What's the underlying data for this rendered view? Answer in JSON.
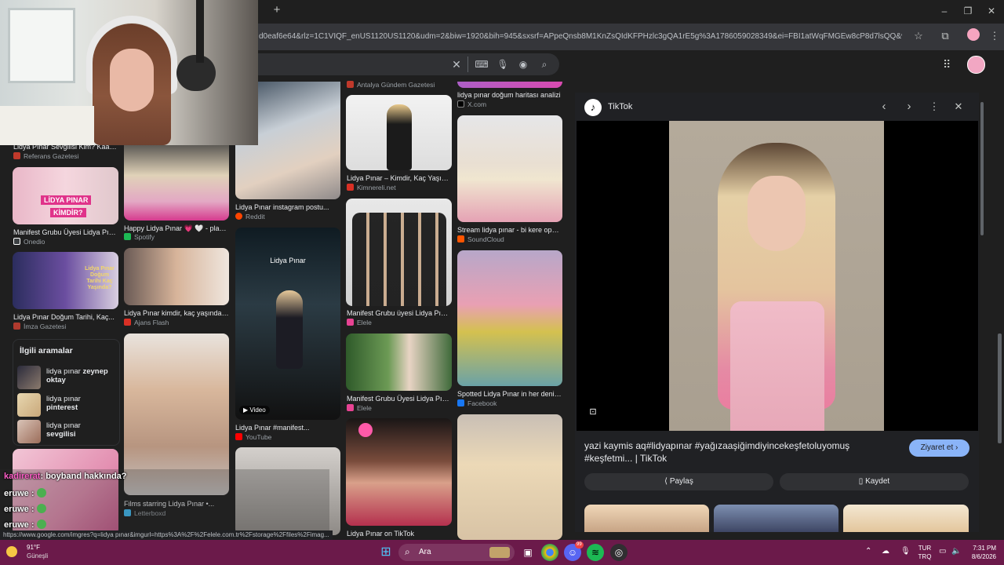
{
  "browser": {
    "url": "d0eaf6e64&rlz=1C1VIQF_enUS1120US1120&udm=2&biw=1920&bih=945&sxsrf=APpeQnsb8M1KnZsQIdKFPHzlc3gQA1rE5g%3A1786059028349&ei=FBI1atWqFMGEw8cP8d7lsQQ&ved=0ahUKEwjVh..."
  },
  "status_url": "https://www.google.com/imgres?q=lidya pınar&imgurl=https%3A%2F%2Felele.com.tr%2Fstorage%2Ffiles%2Fimag...",
  "results": {
    "col1": [
      {
        "caption": "Lidya Pınar Sevgilisi Kim? Kaan...",
        "source": "Referans Gazetesi",
        "color": "#c0392b"
      },
      {
        "caption": "Manifest Grubu Üyesi Lidya Pına...",
        "source": "Onedio",
        "color": "#3c4043",
        "overlay1": "LİDYA PINAR",
        "overlay2": "KİMDİR?"
      },
      {
        "caption": "Lidya Pınar Doğum Tarihi, Kaç...",
        "source": "İmza Gazetesi",
        "color": "#b03a2e",
        "overlay1": "Lidya Pınar Doğum Tarihi Kaç Yaşında?"
      }
    ],
    "col2": [
      {
        "caption": "Happy Lidya Pınar 💗 🤍 - playlis...",
        "source": "Spotify",
        "color": "#1db954"
      },
      {
        "caption": "Lidya Pınar kimdir, kaç yaşında,...",
        "source": "Ajans Flash",
        "color": "#d93025"
      },
      {
        "caption": "Films starring Lidya Pınar •...",
        "source": "Letterboxd",
        "color": "#40bcf4"
      }
    ],
    "col3": [
      {
        "caption": "Lidya Pınar instagram postu...",
        "source": "Reddit",
        "color": "#ff4500"
      },
      {
        "caption": "Lidya Pınar #manifest...",
        "source": "YouTube",
        "color": "#ff0000",
        "overlay1": "Lidya Pınar",
        "badge": "Video"
      }
    ],
    "col4": [
      {
        "caption": "",
        "source": "Antalya Gündem Gazetesi",
        "color": "#c0392b"
      },
      {
        "caption": "Lidya Pınar – Kimdir, Kaç Yaşında...",
        "source": "Kimnereli.net",
        "color": "#d93025"
      },
      {
        "caption": "Manifest Grubu üyesi Lidya Pınar...",
        "source": "Elele",
        "color": "#e84393"
      },
      {
        "caption": "Manifest Grubu Üyesi Lidya Pınar...",
        "source": "Elele",
        "color": "#e84393"
      },
      {
        "caption": "Lidya Pınar on TikTok",
        "source": "",
        "color": "#000"
      }
    ],
    "col5": [
      {
        "caption": "lidya pınar doğum haritası analizi",
        "source": "X.com",
        "color": "#000"
      },
      {
        "caption": "Stream lidya pınar - bi kere opse...",
        "source": "SoundCloud",
        "color": "#ff5500"
      },
      {
        "caption": "Spotted Lidya Pınar in her denim...",
        "source": "Facebook",
        "color": "#1877f2"
      }
    ]
  },
  "related": {
    "title": "İlgili aramalar",
    "items": [
      {
        "prefix": "lidya pınar",
        "bold": "zeynep oktay"
      },
      {
        "prefix": "lidya pınar",
        "bold": "pinterest"
      },
      {
        "prefix": "lidya pınar",
        "bold": "sevgilisi"
      }
    ]
  },
  "panel": {
    "site": "TikTok",
    "title": "yazi kaymis aq#lidyapınar #yağızaaşiğimdiyincekeşfetoluyomuş #keşfetmi... | TikTok",
    "visit_label": "Ziyaret et",
    "share_label": "Paylaş",
    "save_label": "Kaydet"
  },
  "chat": [
    {
      "user": "kadirerat",
      "msg": ": boyband hakkında?",
      "color": "#ff5ec8"
    },
    {
      "user": "eruwe",
      "msg": ":",
      "color": "#ffffff"
    },
    {
      "user": "eruwe",
      "msg": ":",
      "color": "#ffffff"
    },
    {
      "user": "eruwe",
      "msg": ":",
      "color": "#ffffff"
    }
  ],
  "taskbar": {
    "search_label": "Ara",
    "weather_temp": "91°F",
    "weather_desc": "Güneşli",
    "lang_1": "TUR",
    "lang_2": "TRQ",
    "time": "7:31 PM",
    "date": "8/6/2026",
    "discord_badge": "99"
  }
}
